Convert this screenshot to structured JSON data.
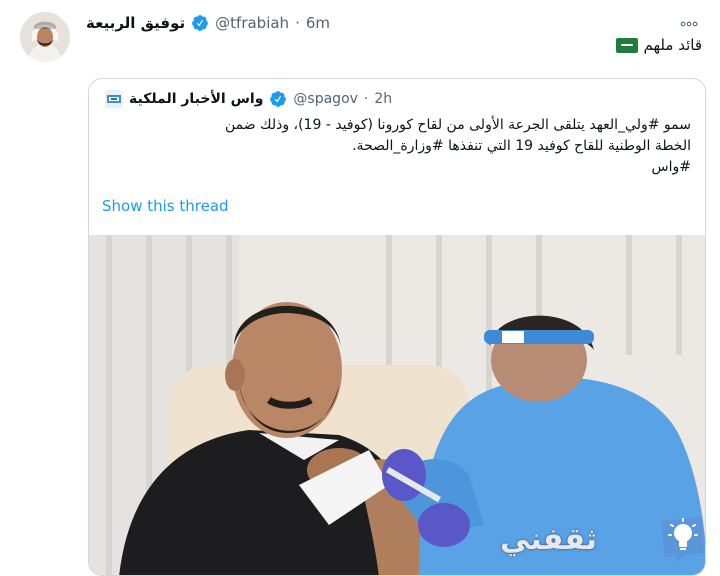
{
  "tweet": {
    "author_name": "توفيق الربيعة",
    "author_handle": "@tfrabiah",
    "separator": "·",
    "time": "6m",
    "more_icon": "more-icon",
    "text": "قائد ملهم"
  },
  "quoted_tweet": {
    "author_name": "واس الأخبار الملكية",
    "author_handle": "@spagov",
    "separator": "·",
    "time": "2h",
    "text_lines": [
      "سمو #ولي_العهد يتلقى الجرعة الأولى من لقاح كورونا (كوفيد - 19)، وذلك ضمن",
      "الخطة الوطنية للقاح كوفيد 19 التي تنفذها #وزارة_الصحة.",
      "#واس"
    ],
    "show_thread": "Show this thread"
  },
  "watermark": {
    "text": "ثقفني"
  },
  "colors": {
    "link": "#1d9bf0",
    "verified": "#1d9bf0",
    "secondary_text": "#536471",
    "border": "#cfd9de"
  }
}
